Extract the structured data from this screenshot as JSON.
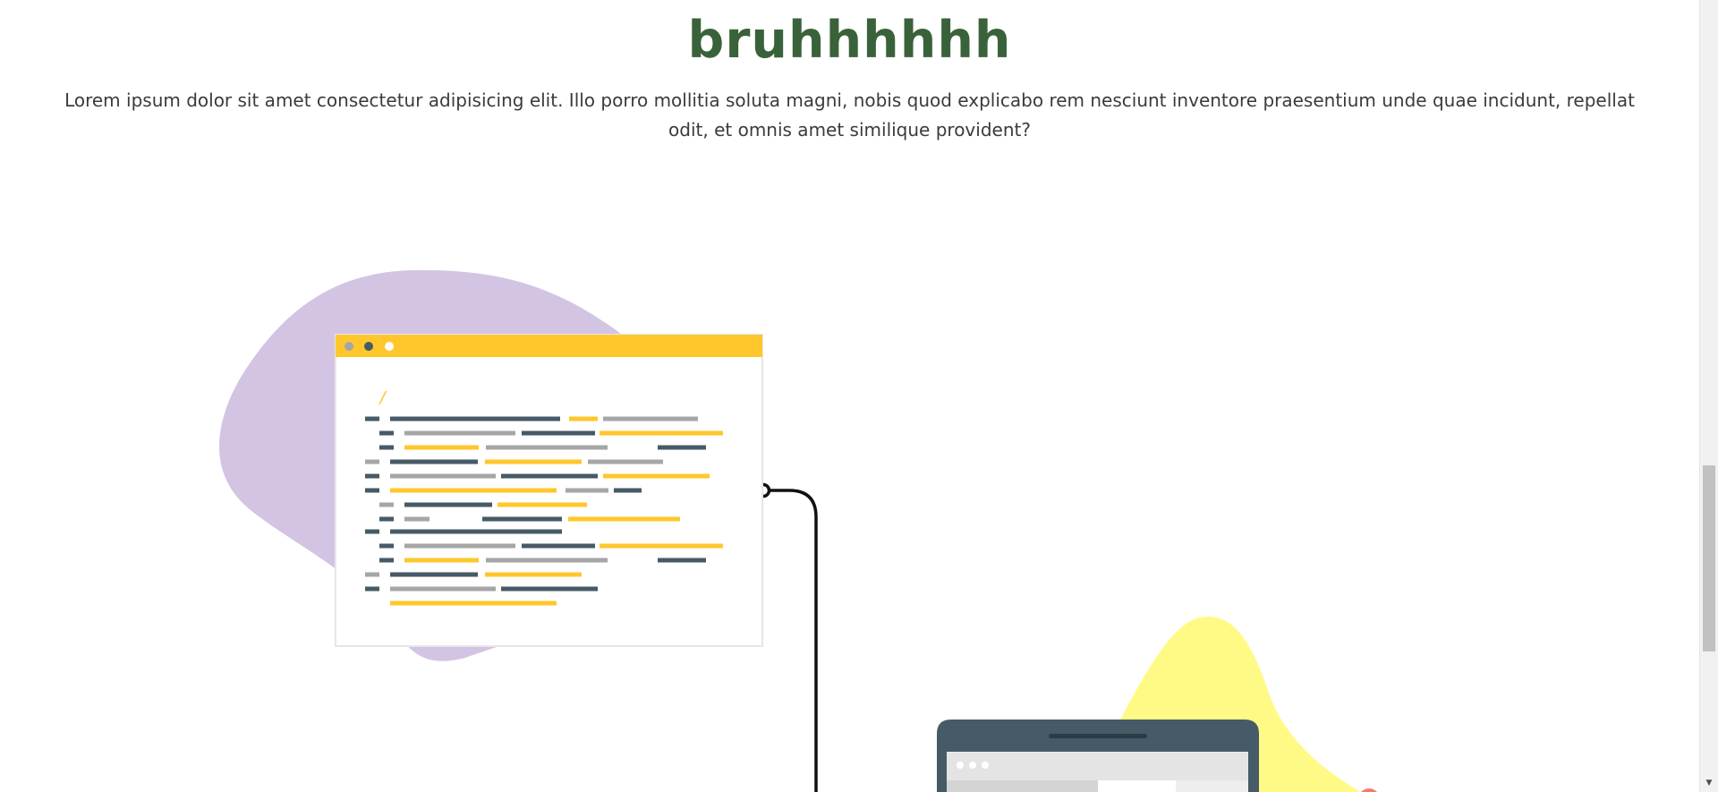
{
  "hero": {
    "title": "bruhhhhhh",
    "text": "Lorem ipsum dolor sit amet consectetur adipisicing elit. Illo porro mollitia soluta magni, nobis quod explicabo rem nesciunt inventore praesentium unde quae incidunt, repellat odit, et omnis amet similique provident?"
  },
  "code_window": {
    "slash": "/"
  },
  "colors": {
    "title_green": "#3a623a",
    "purple_blob": "#d4c4e3",
    "yellow_blob": "#fffa86",
    "window_bar": "#ffc72c",
    "dark_slate": "#465a67",
    "code_gray": "#a6a6a6"
  },
  "icons": {
    "window_dots": "three-window-dots",
    "connector": "connector-line",
    "scroll_down": "arrow-down"
  },
  "scrollbar": {
    "down_arrow": "▼"
  }
}
